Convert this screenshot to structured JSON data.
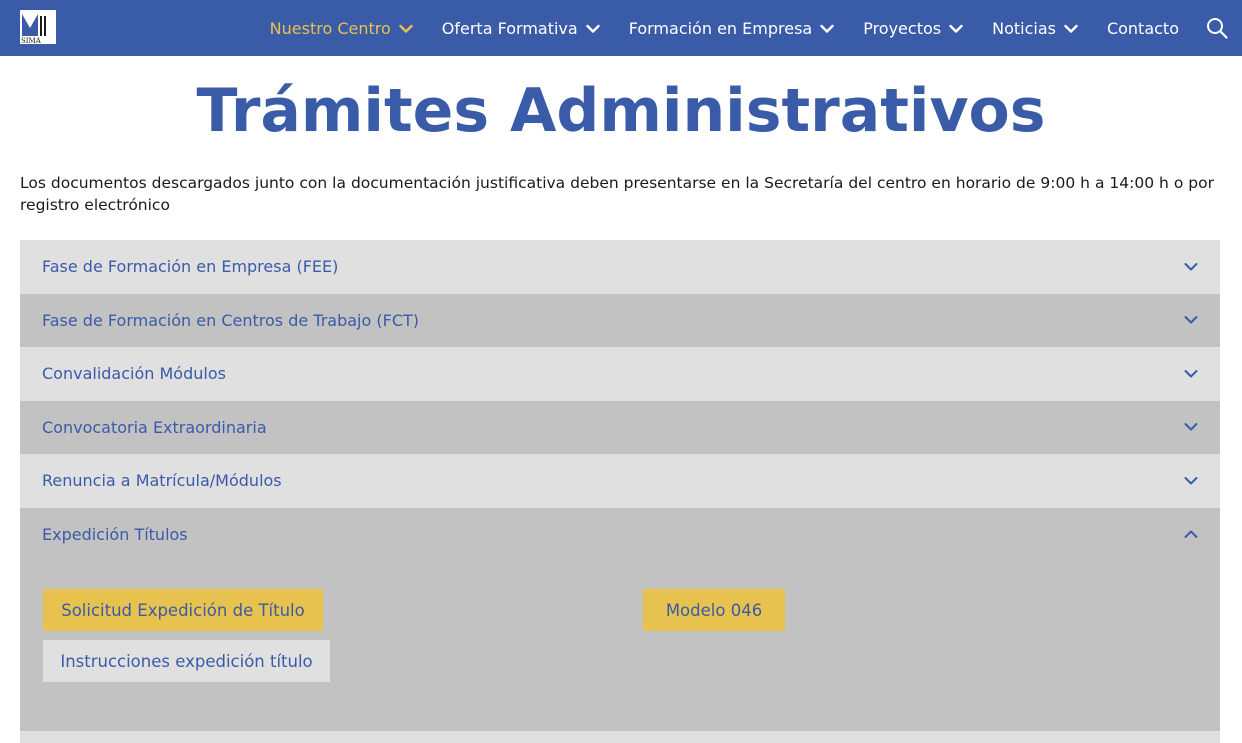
{
  "header": {
    "logo_alt": "SIMA",
    "nav": [
      {
        "label": "Nuestro Centro",
        "active": true,
        "dropdown": true
      },
      {
        "label": "Oferta Formativa",
        "active": false,
        "dropdown": true
      },
      {
        "label": "Formación en Empresa",
        "active": false,
        "dropdown": true
      },
      {
        "label": "Proyectos",
        "active": false,
        "dropdown": true
      },
      {
        "label": "Noticias",
        "active": false,
        "dropdown": true
      },
      {
        "label": "Contacto",
        "active": false,
        "dropdown": false
      }
    ],
    "search_icon": "search-icon"
  },
  "main": {
    "title": "Trámites Administrativos",
    "intro": "Los documentos descargados junto con la documentación justificativa deben presentarse en la Secretaría del centro en horario de 9:00 h a 14:00 h o por registro electrónico"
  },
  "accordion": [
    {
      "label": "Fase de Formación en Empresa (FEE)",
      "expanded": false
    },
    {
      "label": "Fase de Formación en Centros de Trabajo (FCT)",
      "expanded": false
    },
    {
      "label": "Convalidación Módulos",
      "expanded": false
    },
    {
      "label": "Convocatoria Extraordinaria",
      "expanded": false
    },
    {
      "label": "Renuncia a Matrícula/Módulos",
      "expanded": false
    },
    {
      "label": "Expedición Títulos",
      "expanded": true
    }
  ],
  "expedicion_buttons": {
    "solicitud": "Solicitud Expedición de Título",
    "modelo": "Modelo 046",
    "instrucciones": "Instrucciones expedición título"
  },
  "colors": {
    "brand_blue": "#3a5ba8",
    "accent_yellow": "#e8c24e",
    "panel_light": "#e0e0e1",
    "panel_dark": "#c2c2c3"
  }
}
